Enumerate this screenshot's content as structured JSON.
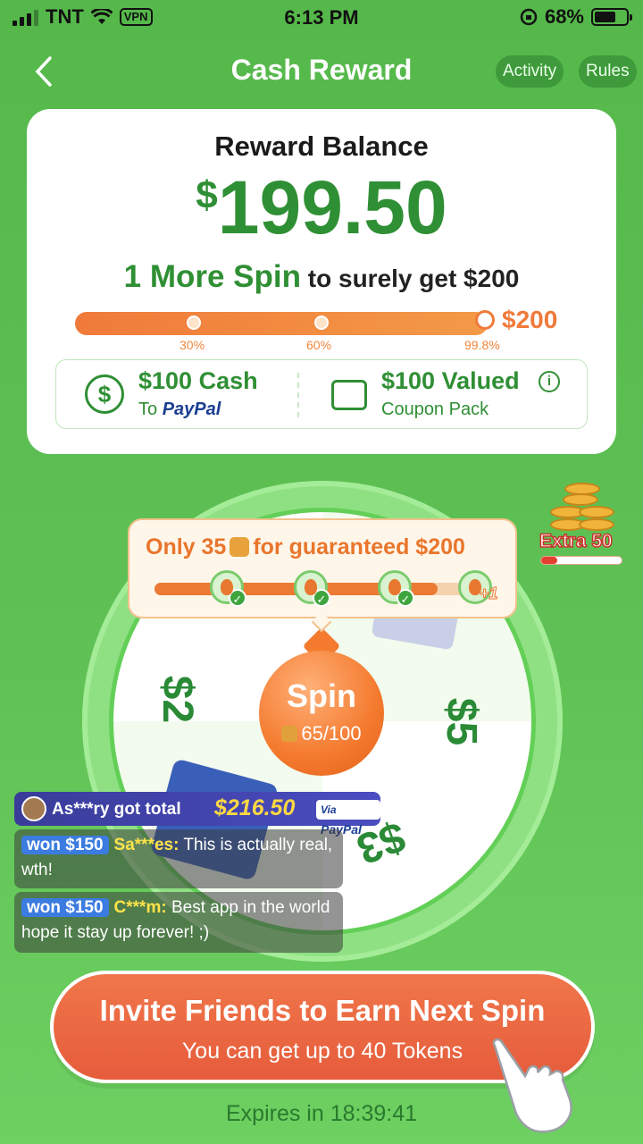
{
  "status_bar": {
    "carrier": "TNT",
    "vpn": "VPN",
    "time": "6:13 PM",
    "battery": "68%",
    "battery_level": 0.68
  },
  "header": {
    "back_icon": "chevron-left-icon",
    "title": "Cash Reward",
    "activity_label": "Activity",
    "rules_label": "Rules"
  },
  "balance": {
    "label": "Reward Balance",
    "currency": "$",
    "amount": "199.50",
    "spin_highlight": "1 More Spin",
    "spin_rest": " to surely get $200",
    "goal": "$200",
    "progress": 0.9975,
    "milestones": [
      "30%",
      "60%",
      "99.8%"
    ]
  },
  "options": {
    "cash_title": "$100 Cash",
    "cash_sub_prefix": "To ",
    "cash_sub_brand": "PayPal",
    "coupon_title": "$100 Valued",
    "coupon_sub": "Coupon Pack"
  },
  "wheel": {
    "prize_left": "$2",
    "prize_right": "$5",
    "prize_bottom": "$3",
    "spin_label": "Spin",
    "spin_count": "65/100"
  },
  "token_tip": {
    "text_prefix": "Only 35",
    "text_suffix": "for guaranteed $200",
    "plus": "+1",
    "progress": 0.88
  },
  "extra": {
    "label": "Extra 50",
    "progress": 0.2
  },
  "feed": {
    "top_user_text": "As***ry got total",
    "top_amount": "$216.50",
    "via_label": "Via",
    "via_brand": "PayPal",
    "items": [
      {
        "badge": "won $150",
        "user": "Sa***es:",
        "message": " This is actually real, wth!"
      },
      {
        "badge": "won $150",
        "user": "C***m:",
        "message": " Best app in the world hope it stay up forever! ;)"
      }
    ]
  },
  "cta": {
    "title": "Invite Friends to Earn Next Spin",
    "subtitle": "You can get up to 40 Tokens"
  },
  "expires": "Expires in 18:39:41",
  "colors": {
    "background": "#5fc155",
    "accent_green": "#2f8f34",
    "accent_orange": "#f07a3a",
    "cta": "#e65c3c"
  }
}
